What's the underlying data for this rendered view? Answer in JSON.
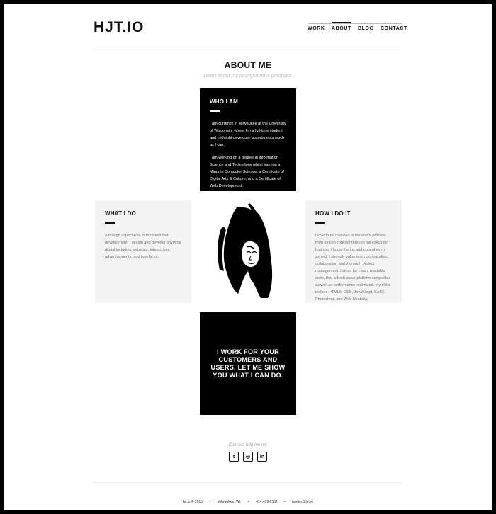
{
  "header": {
    "logo": "HJT.IO",
    "nav": [
      {
        "label": "WORK",
        "active": false
      },
      {
        "label": "ABOUT",
        "active": true
      },
      {
        "label": "BLOG",
        "active": false
      },
      {
        "label": "CONTACT",
        "active": false
      }
    ]
  },
  "page": {
    "title": "ABOUT ME",
    "subtitle": "Learn about my background & practices."
  },
  "cards": {
    "who": {
      "heading": "WHO I AM",
      "p1": "I am currently in Milwaukee at the University of Wisconsin, where I'm a full-time student and midnight developer absorbing as much as I can.",
      "p2": "I am working on a degree in Information Science and Technology whilst earning a Minor in Computer Science, a Certificate of Digital Arts & Culture, and a Certificate of Web Development."
    },
    "what": {
      "heading": "WHAT I DO",
      "p1": "Although I specialize in front end web development, I design and develop anything digital including websites, interactives, advertisements, and typefaces."
    },
    "how": {
      "heading": "HOW I DO IT",
      "p1": "I love to be involved in the entire process from design concept through full execution that way I know the ins and outs of every aspect. I strongly value team organization, collaboration and thorough project management. I strive for clean, readable code, that is both cross-platform compatible as well as performance optimized. My skills include HTML5, CSS, JavaScript, SASS, Photoshop, and Web Usability."
    },
    "cta": {
      "text": "I WORK FOR YOUR CUSTOMERS AND USERS, LET ME SHOW YOU WHAT I CAN DO."
    }
  },
  "social": {
    "connect_label": "Connect with me on:",
    "icons": [
      "twitter-icon",
      "github-icon",
      "linkedin-icon"
    ],
    "twitter_glyph": "t",
    "github_glyph": "◎",
    "linkedin_glyph": "in"
  },
  "footer": {
    "copyright": "hjt.io © 2015",
    "location": "Milwaukee, WI.",
    "phone": "414.429.6582",
    "email": "hunter@hjt.io",
    "separator": "•"
  }
}
